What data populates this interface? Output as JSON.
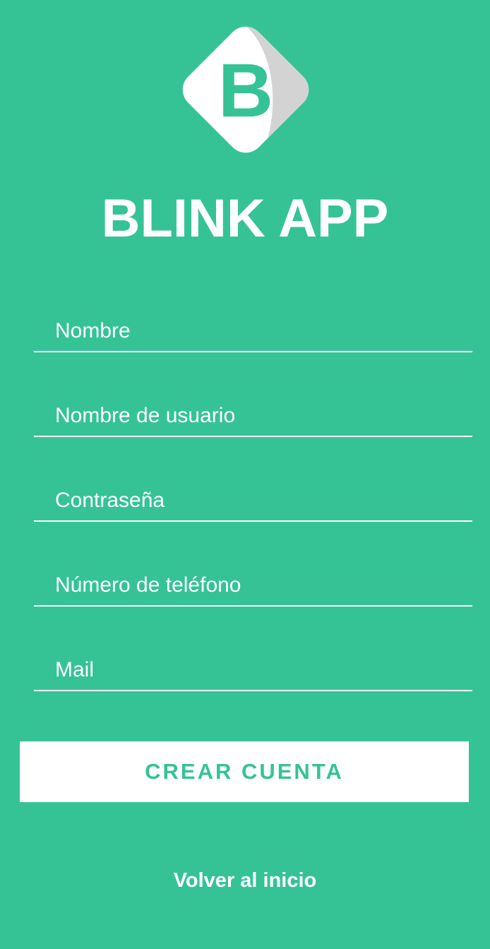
{
  "app": {
    "title": "BLINK APP",
    "logo_letter": "B",
    "logo_icon": "blink-logo-icon"
  },
  "form": {
    "name_placeholder": "Nombre",
    "username_placeholder": "Nombre de usuario",
    "password_placeholder": "Contraseña",
    "phone_placeholder": "Número de teléfono",
    "mail_placeholder": "Mail"
  },
  "actions": {
    "create_account_label": "CREAR CUENTA",
    "back_home_label": "Volver al inicio"
  },
  "colors": {
    "background": "#35c396",
    "accent": "#35c396",
    "text": "#ffffff",
    "logo_shadow": "#d3d3d3"
  }
}
